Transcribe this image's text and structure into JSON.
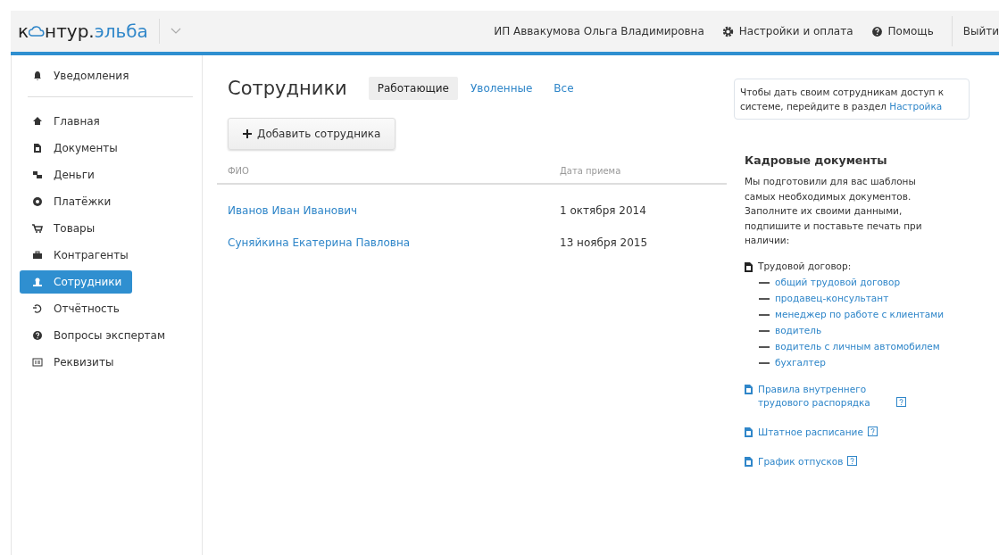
{
  "header": {
    "logo": {
      "lead": "к",
      "rest": "нтур.",
      "accent": "эльба"
    },
    "account": "ИП Аввакумова Ольга Владимировна",
    "settings": "Настройки и оплата",
    "help": "Помощь",
    "logout": "Выйти"
  },
  "sidebar": {
    "notifications": {
      "label": "Уведомления",
      "selected": false
    },
    "items": [
      {
        "label": "Главная",
        "selected": false
      },
      {
        "label": "Документы",
        "selected": false
      },
      {
        "label": "Деньги",
        "selected": false
      },
      {
        "label": "Платёжки",
        "selected": false
      },
      {
        "label": "Товары",
        "selected": false
      },
      {
        "label": "Контрагенты",
        "selected": false
      },
      {
        "label": "Сотрудники",
        "selected": true
      },
      {
        "label": "Отчётность",
        "selected": false
      },
      {
        "label": "Вопросы экспертам",
        "selected": false
      },
      {
        "label": "Реквизиты",
        "selected": false
      }
    ]
  },
  "main": {
    "title": "Сотрудники",
    "tabs": [
      {
        "label": "Работающие",
        "selected": true
      },
      {
        "label": "Уволенные",
        "selected": false
      },
      {
        "label": "Все",
        "selected": false
      }
    ],
    "add_button": "Добавить сотрудника",
    "table": {
      "columns": [
        "ФИО",
        "Дата приема"
      ],
      "rows": [
        [
          "Иванов Иван Иванович",
          "1 октября 2014"
        ],
        [
          "Суняйкина Екатерина Павловна",
          "13 ноября 2015"
        ]
      ]
    }
  },
  "aside": {
    "notice": {
      "text": "Чтобы дать своим сотрудникам доступ к системе, перейдите в раздел ",
      "link": "Настройка"
    },
    "hr_docs": {
      "title": "Кадровые документы",
      "intro": "Мы подготовили для вас шаблоны самых необходимых документов. Заполните их своими данными, подпишите и поставьте печать при наличии:",
      "contract": {
        "label": "Трудовой договор:",
        "items": [
          "общий трудовой договор",
          "продавец-консультант",
          "менеджер по работе с клиентами",
          "водитель",
          "водитель с личным автомобилем",
          "бухгалтер"
        ]
      },
      "documents": [
        "Правила внутреннего трудового распорядка",
        "Штатное расписание",
        "График отпусков"
      ]
    }
  }
}
